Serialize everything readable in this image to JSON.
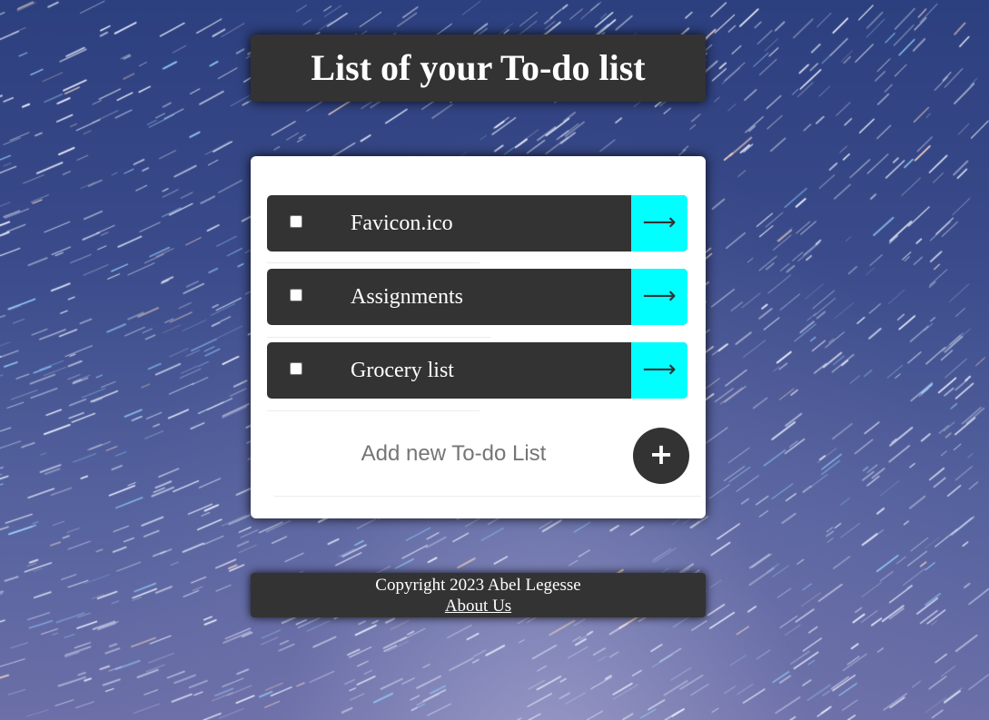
{
  "header": {
    "title": "List of your To-do list"
  },
  "todos": [
    {
      "label": "Favicon.ico",
      "arrow": "⟶"
    },
    {
      "label": "Assignments",
      "arrow": "⟶"
    },
    {
      "label": "Grocery list",
      "arrow": "⟶"
    }
  ],
  "add": {
    "placeholder": "Add new To-do List",
    "button_label": "+"
  },
  "footer": {
    "copyright": "Copyright 2023 Abel Legesse",
    "about_link": "About Us"
  },
  "colors": {
    "panel_dark": "#333333",
    "accent_cyan": "#00ffff",
    "card_white": "#ffffff",
    "placeholder_gray": "#757575"
  }
}
